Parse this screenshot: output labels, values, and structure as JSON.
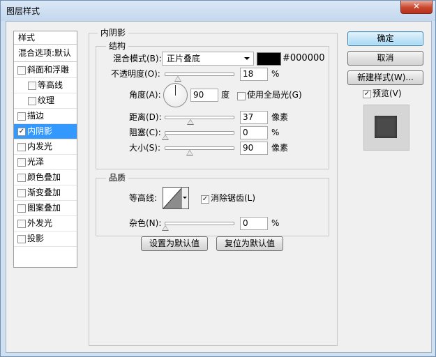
{
  "window": {
    "title": "图层样式",
    "close_label": "✕"
  },
  "sidebar": {
    "header": "样式",
    "blend_item": "混合选项:默认",
    "items": [
      {
        "label": "斜面和浮雕",
        "checked": false,
        "indent": false,
        "selected": false
      },
      {
        "label": "等高线",
        "checked": false,
        "indent": true,
        "selected": false
      },
      {
        "label": "纹理",
        "checked": false,
        "indent": true,
        "selected": false
      },
      {
        "label": "描边",
        "checked": false,
        "indent": false,
        "selected": false
      },
      {
        "label": "内阴影",
        "checked": true,
        "indent": false,
        "selected": true
      },
      {
        "label": "内发光",
        "checked": false,
        "indent": false,
        "selected": false
      },
      {
        "label": "光泽",
        "checked": false,
        "indent": false,
        "selected": false
      },
      {
        "label": "颜色叠加",
        "checked": false,
        "indent": false,
        "selected": false
      },
      {
        "label": "渐变叠加",
        "checked": false,
        "indent": false,
        "selected": false
      },
      {
        "label": "图案叠加",
        "checked": false,
        "indent": false,
        "selected": false
      },
      {
        "label": "外发光",
        "checked": false,
        "indent": false,
        "selected": false
      },
      {
        "label": "投影",
        "checked": false,
        "indent": false,
        "selected": false
      }
    ]
  },
  "panel": {
    "title": "内阴影",
    "structure": {
      "legend": "结构",
      "blend_mode_label": "混合模式(B):",
      "blend_mode_value": "正片叠底",
      "color_hex": "#000000",
      "opacity_label": "不透明度(O):",
      "opacity_value": "18",
      "opacity_unit": "%",
      "angle_label": "角度(A):",
      "angle_value": "90",
      "angle_unit": "度",
      "global_light_label": "使用全局光(G)",
      "global_light_checked": false,
      "distance_label": "距离(D):",
      "distance_value": "37",
      "distance_unit": "像素",
      "choke_label": "阻塞(C):",
      "choke_value": "0",
      "choke_unit": "%",
      "size_label": "大小(S):",
      "size_value": "90",
      "size_unit": "像素"
    },
    "quality": {
      "legend": "品质",
      "contour_label": "等高线:",
      "antialias_label": "消除锯齿(L)",
      "antialias_checked": true,
      "noise_label": "杂色(N):",
      "noise_value": "0",
      "noise_unit": "%"
    },
    "make_default_label": "设置为默认值",
    "reset_default_label": "复位为默认值"
  },
  "actions": {
    "ok_label": "确定",
    "cancel_label": "取消",
    "new_style_label": "新建样式(W)...",
    "preview_label": "预览(V)",
    "preview_checked": true
  },
  "sliders": {
    "opacity_fraction": 0.18,
    "distance_fraction": 0.37,
    "choke_fraction": 0.0,
    "size_fraction": 0.36,
    "noise_fraction": 0.0
  }
}
